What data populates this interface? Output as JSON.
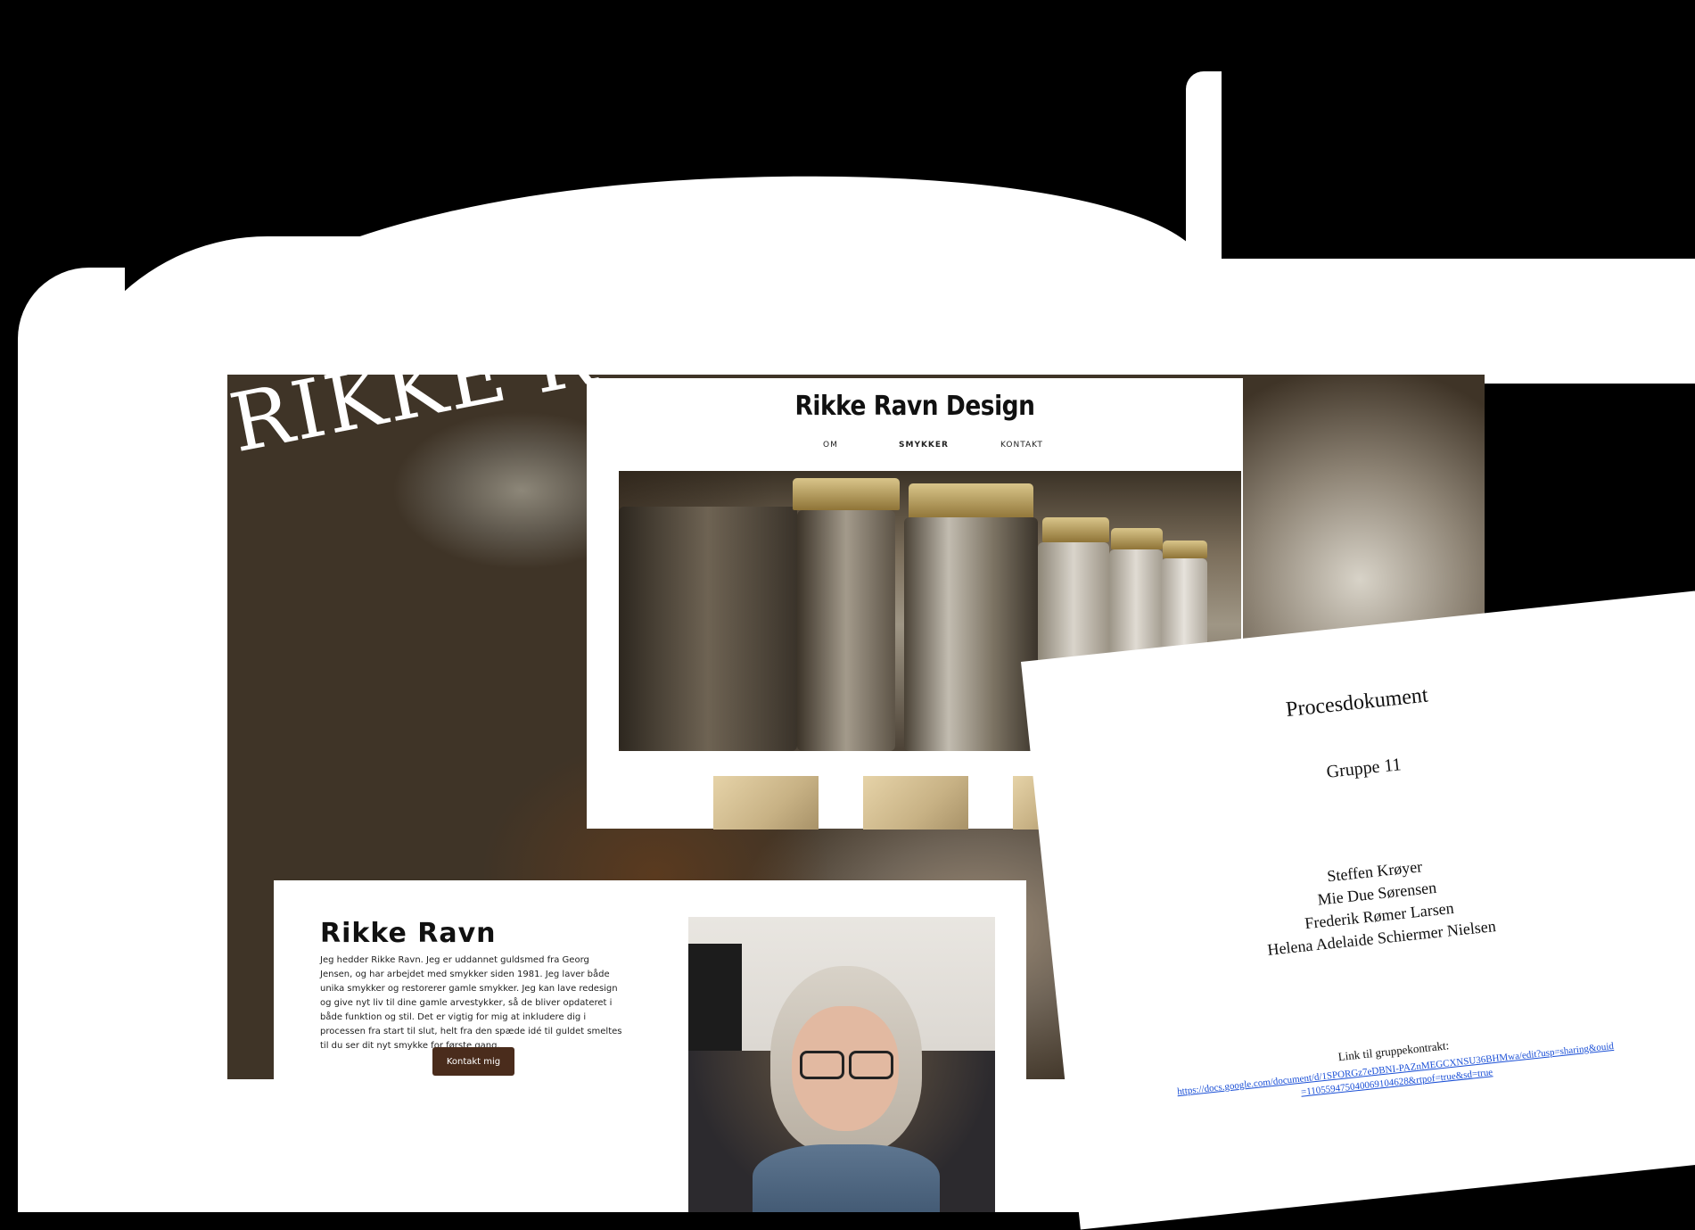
{
  "background": {
    "big_title": "RIKKE R"
  },
  "site": {
    "logo": "Rikke Ravn Design",
    "nav": [
      "OM",
      "SMYKKER",
      "KONTAKT"
    ],
    "active_nav": "SMYKKER"
  },
  "about": {
    "title": "Rikke Ravn",
    "text": "Jeg hedder Rikke Ravn. Jeg er uddannet guldsmed fra Georg Jensen, og har arbejdet med smykker siden 1981. Jeg laver både unika smykker og restorerer gamle smykker. Jeg kan lave redesign og give nyt liv til dine gamle arvestykker, så de bliver opdateret i både funktion og stil. Det er vigtig for mig at inkludere dig i processen fra start til slut, helt fra den spæde idé til guldet smeltes til du ser dit nyt smykke for første gang.",
    "button": "Kontakt mig"
  },
  "document": {
    "title": "Procesdokument",
    "group": "Gruppe 11",
    "members": [
      "Steffen Krøyer",
      "Mie Due Sørensen",
      "Frederik Rømer Larsen",
      "Helena Adelaide Schiermer Nielsen"
    ],
    "link_label": "Link til gruppekontrakt:",
    "link_line1": "https://docs.google.com/document/d/1SPORGz7eDBNI-PAZnMEGCXNSU36BHMwa/edit?usp=sharing&ouid",
    "link_line2": "=110559475040069104628&rtpof=true&sd=true"
  }
}
